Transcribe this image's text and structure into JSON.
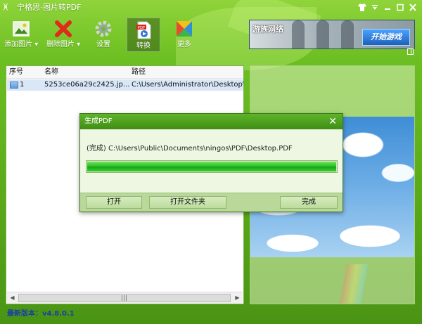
{
  "window": {
    "title": "宁格思-图片转PDF",
    "app_icon_glyph": "ᚸ",
    "controls": [
      "shirt-icon",
      "dropdown-icon",
      "minimize-icon",
      "maximize-icon",
      "close-icon"
    ]
  },
  "toolbar": {
    "items": [
      {
        "label": "添加图片",
        "icon": "add-image-icon",
        "has_dropdown": true
      },
      {
        "label": "删除图片",
        "icon": "delete-icon",
        "has_dropdown": true
      },
      {
        "label": "设置",
        "icon": "gear-icon"
      },
      {
        "label": "转换",
        "icon": "pdf-convert-icon",
        "active": true
      },
      {
        "label": "更多",
        "icon": "more-icon"
      }
    ]
  },
  "banner": {
    "brand": "游族网络",
    "cta": "开始游戏"
  },
  "file_list": {
    "columns": [
      "序号",
      "名称",
      "路径"
    ],
    "rows": [
      {
        "index": "1",
        "name": "5253ce06a29c2425.jp...",
        "path": "C:\\Users\\Administrator\\Desktop\\"
      }
    ]
  },
  "status": {
    "version": "最新版本：v4.8.0.1"
  },
  "dialog": {
    "title": "生成PDF",
    "message": "(完成) C:\\Users\\Public\\Documents\\ningos\\PDF\\Desktop.PDF",
    "progress": 1.0,
    "buttons": {
      "open": "打开",
      "open_folder": "打开文件夹",
      "done": "完成"
    }
  },
  "colors": {
    "accent_green": "#4a9414",
    "progress_green": "#2fc12a",
    "version_blue": "#1a3fa6"
  }
}
